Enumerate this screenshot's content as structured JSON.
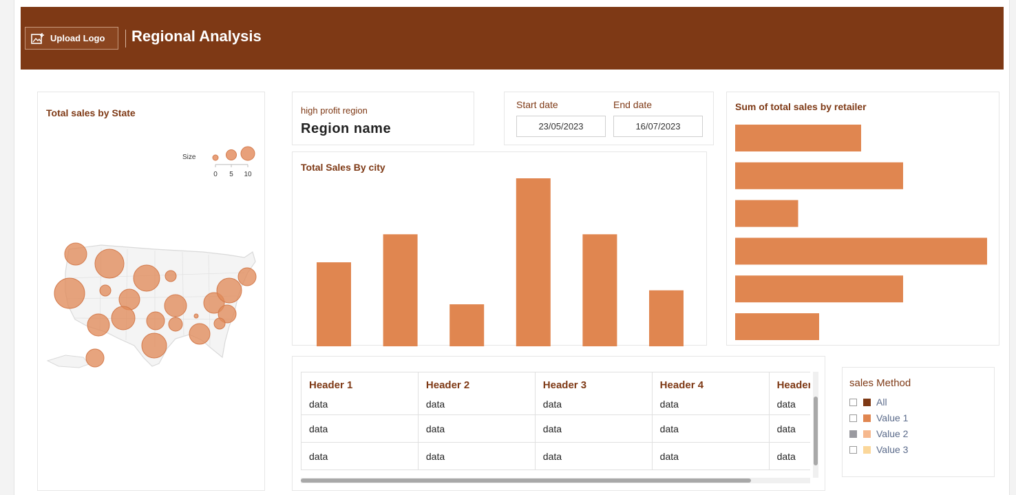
{
  "header": {
    "upload_label": "Upload Logo",
    "title": "Regional Analysis",
    "color": "#7e3915"
  },
  "map": {
    "title": "Total sales by State",
    "size_legend": {
      "label": "Size",
      "ticks": [
        "0",
        "5",
        "10"
      ]
    },
    "bubble_color": "#e08a5a"
  },
  "profit": {
    "label": "high profit region",
    "value": "Region name"
  },
  "dates": {
    "start_label": "Start date",
    "start_value": "23/05/2023",
    "end_label": "End date",
    "end_value": "16/07/2023"
  },
  "chart_data": [
    {
      "type": "bar",
      "title": "Total Sales By city",
      "orientation": "vertical",
      "categories": [
        "",
        "",
        "",
        "",
        "",
        ""
      ],
      "values": [
        60,
        80,
        30,
        120,
        80,
        40
      ],
      "ylim": [
        0,
        120
      ],
      "color": "#e08650",
      "axes_visible": false,
      "grid": false
    },
    {
      "type": "bar",
      "title": "Sum of total sales by retailer",
      "orientation": "horizontal",
      "categories": [
        "",
        "",
        "",
        "",
        "",
        ""
      ],
      "values": [
        60,
        80,
        30,
        120,
        80,
        40
      ],
      "xlim": [
        0,
        120
      ],
      "color": "#e08650",
      "axes_visible": false,
      "grid": false
    }
  ],
  "table": {
    "headers": [
      "Header 1",
      "Header 2",
      "Header 3",
      "Header 4",
      "Header"
    ],
    "rows": [
      [
        "data",
        "data",
        "data",
        "data",
        "data"
      ],
      [
        "data",
        "data",
        "data",
        "data",
        "data"
      ],
      [
        "data",
        "data",
        "data",
        "data",
        "data"
      ]
    ]
  },
  "legend": {
    "title": "sales Method",
    "items": [
      {
        "label": "All",
        "color": "#7e3915",
        "checked": false
      },
      {
        "label": "Value 1",
        "color": "#e08650",
        "checked": false
      },
      {
        "label": "Value 2",
        "color": "#f6b88e",
        "checked": true
      },
      {
        "label": "Value 3",
        "color": "#fbd79a",
        "checked": false
      }
    ]
  }
}
